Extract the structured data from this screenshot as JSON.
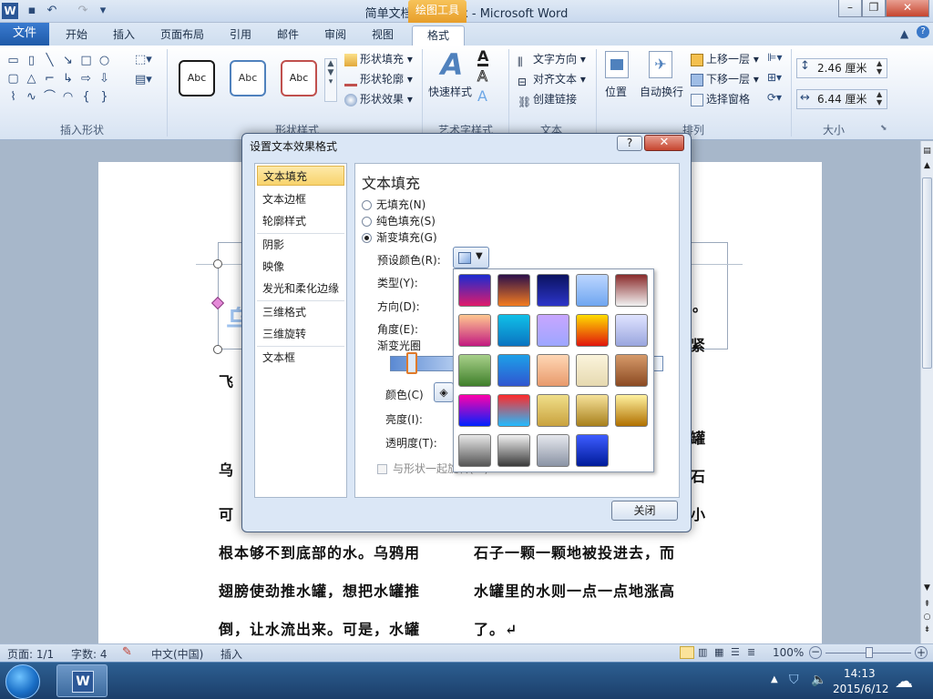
{
  "window": {
    "title": "简单文档排版.docx - Microsoft Word",
    "context_tab_header": "绘图工具",
    "minimize": "–",
    "restore": "❐",
    "close": "✕"
  },
  "tabs": {
    "file": "文件",
    "items": [
      "开始",
      "插入",
      "页面布局",
      "引用",
      "邮件",
      "审阅",
      "视图",
      "格式"
    ]
  },
  "ribbon": {
    "insert_shapes_label": "插入形状",
    "shape_styles_label": "形状样式",
    "wordart_styles_label": "艺术字样式",
    "text_label": "文本",
    "arrange_label": "排列",
    "size_label": "大小",
    "abc": "Abc",
    "shape_fill": "形状填充",
    "shape_outline": "形状轮廓",
    "shape_effects": "形状效果",
    "quick_styles": "快速样式",
    "text_direction": "文字方向",
    "align_text": "对齐文本",
    "create_link": "创建链接",
    "position": "位置",
    "wrap_text": "自动换行",
    "bring_forward": "上移一层",
    "send_backward": "下移一层",
    "selection_pane": "选择窗格",
    "height": "2.46 厘米",
    "width": "6.44 厘米"
  },
  "document": {
    "line_fei": "飞",
    "frag_wu": "乌",
    "frag_ke": "可",
    "frag_right_1": "。",
    "frag_right_2": "紧",
    "frag_right_3": "罐",
    "frag_right_4": "石",
    "frag_right_5": "小",
    "left_col": [
      "根本够不到底部的水。乌鸦用",
      "翅膀使劲推水罐，想把水罐推",
      "倒，让水流出来。可是，水罐"
    ],
    "right_col": [
      "石子一颗一颗地被投进去，而",
      "水罐里的水则一点一点地涨高",
      "了。↵"
    ]
  },
  "dialog": {
    "title": "设置文本效果格式",
    "help": "?",
    "close_x": "✕",
    "categories": [
      "文本填充",
      "文本边框",
      "轮廓样式",
      "阴影",
      "映像",
      "发光和柔化边缘",
      "三维格式",
      "三维旋转",
      "文本框"
    ],
    "panel_title": "文本填充",
    "opt_none": "无填充(N)",
    "opt_solid": "纯色填充(S)",
    "opt_gradient": "渐变填充(G)",
    "preset_colors": "预设颜色(R):",
    "type": "类型(Y):",
    "direction": "方向(D):",
    "angle": "角度(E):",
    "stops": "渐变光圈",
    "color": "颜色(C)",
    "brightness": "亮度(I):",
    "transparency": "透明度(T):",
    "rotate_with_shape": "与形状一起旋转(W)",
    "close_button": "关闭"
  },
  "preset_swatches": [
    [
      "#1a2bd0",
      "#e01b6a",
      "#2b0f4a",
      "#f47c20",
      "#0b1260",
      "#2c34c9",
      "#bcd6ff",
      "#6fa6f0",
      "#8a2b2b",
      "#f2f2f2"
    ],
    [
      "#ffc890",
      "#c21a80",
      "#10c0e8",
      "#0a73c0",
      "#c8a6ff",
      "#9da6ff",
      "#ffdd00",
      "#e0150c",
      "#dfe3ff",
      "#9aa6de"
    ],
    [
      "#a8d08a",
      "#3f7f2a",
      "#1da0e8",
      "#3055d0",
      "#ffd7b5",
      "#e89a6c",
      "#fbf4dc",
      "#e6d9b0",
      "#d69a6a",
      "#8b4a22"
    ],
    [
      "#ff00aa",
      "#0022ff",
      "#ff2a2a",
      "#22bbff",
      "#f0df8a",
      "#c9a23e",
      "#f6e29a",
      "#a8801c",
      "#fff2a0",
      "#b07000"
    ],
    [
      "#e8e8e8",
      "#555555",
      "#f2f2f2",
      "#3a3a3a",
      "#e6e8ee",
      "#8a93a4",
      "#3d5cff",
      "#001b9a"
    ]
  ],
  "status": {
    "page": "页面: 1/1",
    "words": "字数: 4",
    "language": "中文(中国)",
    "mode": "插入",
    "zoom": "100%"
  },
  "taskbar": {
    "time": "14:13",
    "date": "2015/6/12"
  }
}
